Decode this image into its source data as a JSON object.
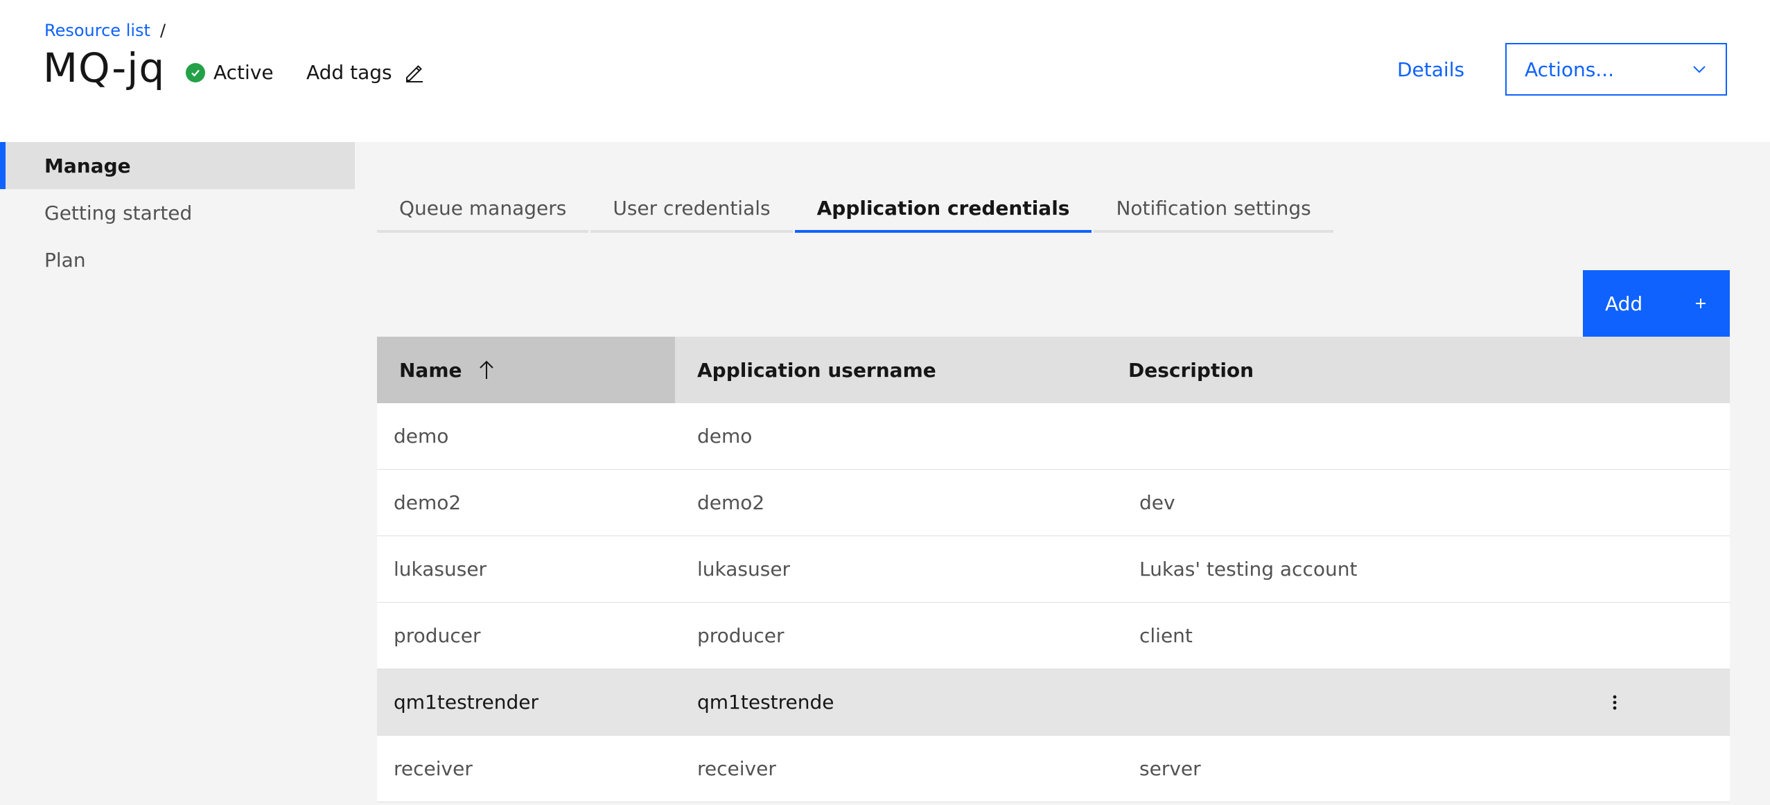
{
  "breadcrumb": {
    "link": "Resource list",
    "separator": "/"
  },
  "title": "MQ-jq",
  "status": {
    "label": "Active",
    "color": "#24a148",
    "icon": "checkmark-filled-icon"
  },
  "add_tags": {
    "label": "Add tags",
    "icon": "edit-icon"
  },
  "header_actions": {
    "details": "Details",
    "actions": "Actions...",
    "actions_icon": "chevron-down-icon"
  },
  "sidebar": {
    "items": [
      {
        "label": "Manage",
        "active": true
      },
      {
        "label": "Getting started",
        "active": false
      },
      {
        "label": "Plan",
        "active": false
      }
    ]
  },
  "tabs": [
    {
      "label": "Queue managers",
      "active": false
    },
    {
      "label": "User credentials",
      "active": false
    },
    {
      "label": "Application credentials",
      "active": true
    },
    {
      "label": "Notification settings",
      "active": false
    }
  ],
  "add_button": {
    "label": "Add",
    "icon": "plus-icon"
  },
  "table": {
    "columns": [
      "Name",
      "Application username",
      "Description"
    ],
    "sort": {
      "column": "Name",
      "direction": "ascending",
      "icon": "arrow-up-icon"
    },
    "rows": [
      {
        "name": "demo",
        "username": "demo",
        "description": ""
      },
      {
        "name": "demo2",
        "username": "demo2",
        "description": "dev"
      },
      {
        "name": "lukasuser",
        "username": "lukasuser",
        "description": "Lukas' testing account"
      },
      {
        "name": "producer",
        "username": "producer",
        "description": "client"
      },
      {
        "name": "qm1testrender",
        "username": "qm1testrende",
        "description": "",
        "hovered": true
      },
      {
        "name": "receiver",
        "username": "receiver",
        "description": "server"
      }
    ]
  },
  "colors": {
    "accent": "#0f62fe",
    "success": "#24a148",
    "page_bg": "#f4f4f4"
  }
}
